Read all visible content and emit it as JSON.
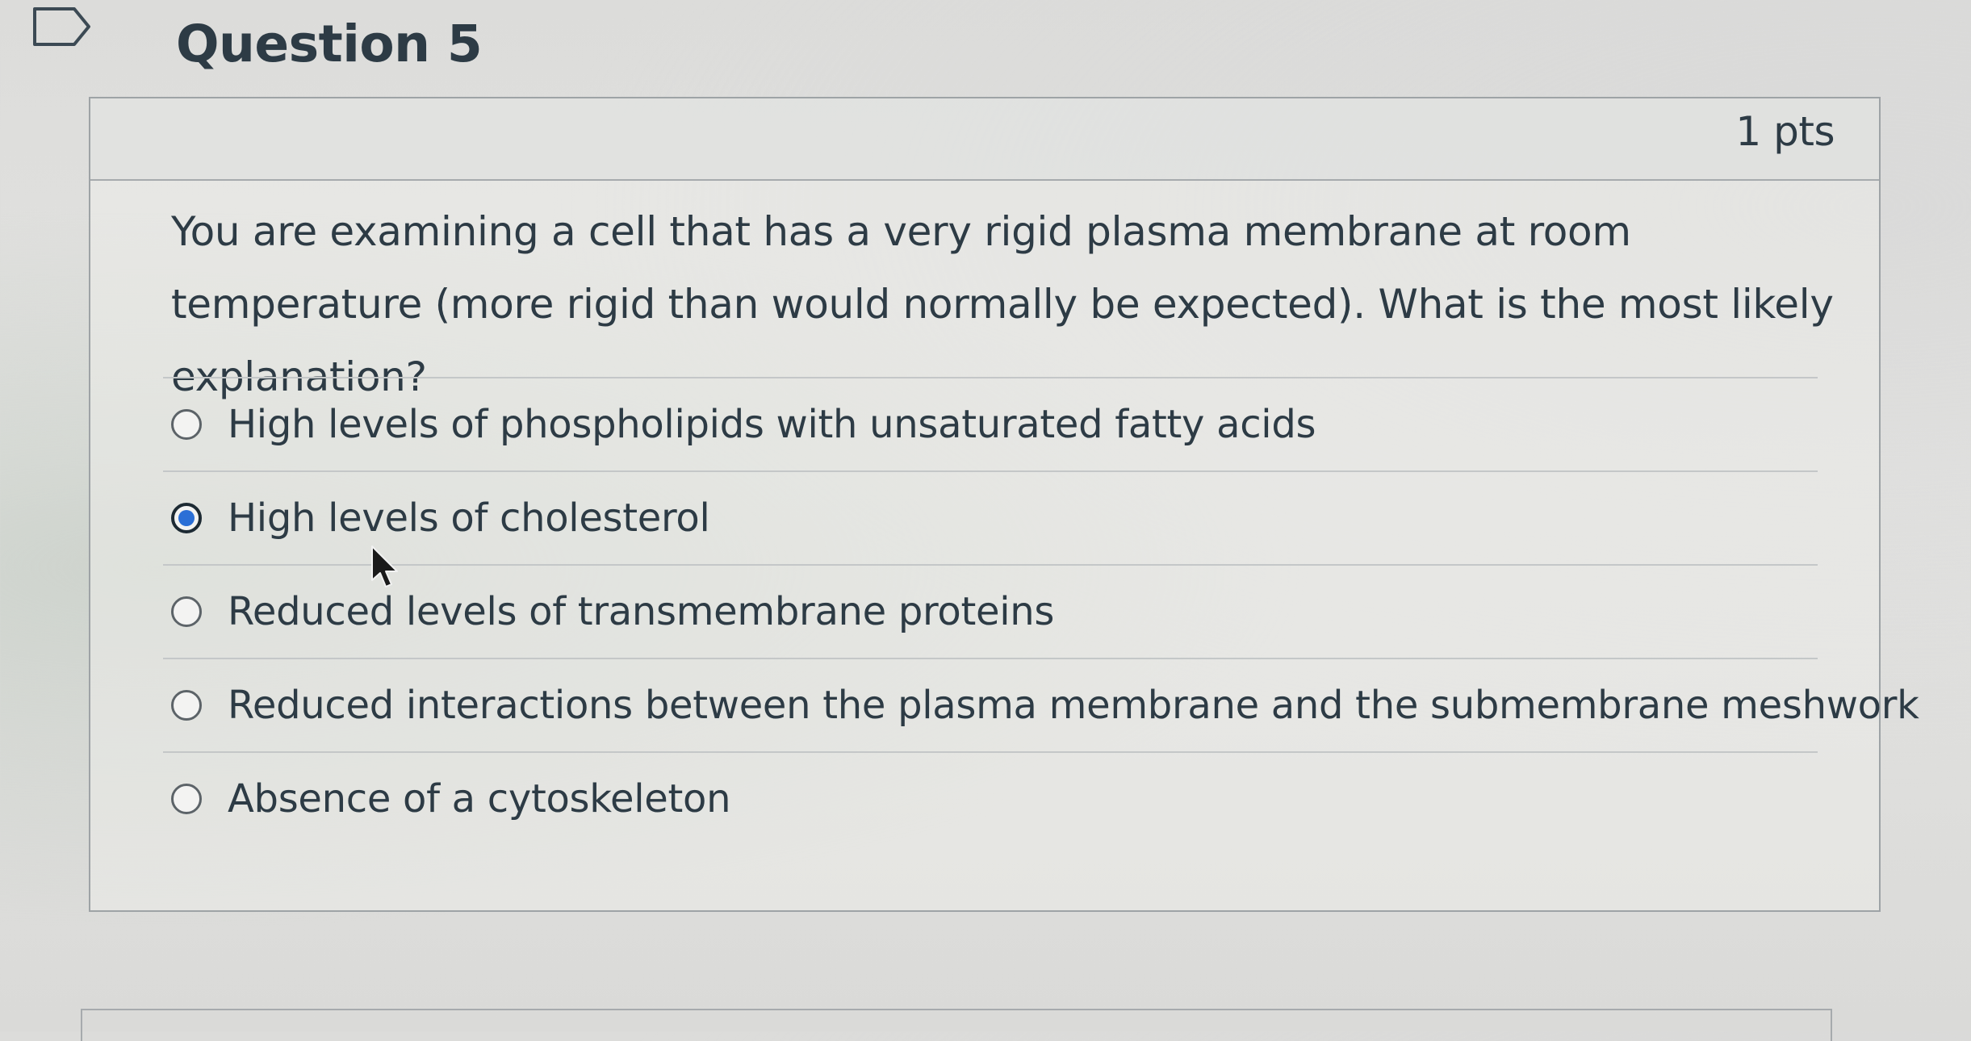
{
  "question": {
    "title": "Question 5",
    "points": "1 pts",
    "text": "You are examining a cell that has a very rigid plasma membrane at room temperature (more rigid than would normally be expected). What is the most likely explanation?",
    "selected_index": 1,
    "answers": [
      {
        "label": "High levels of phospholipids with unsaturated fatty acids",
        "checked": false
      },
      {
        "label": "High levels of cholesterol",
        "checked": true
      },
      {
        "label": "Reduced levels of transmembrane proteins",
        "checked": false
      },
      {
        "label": "Reduced interactions between the plasma membrane and the submembrane meshwork",
        "checked": false
      },
      {
        "label": "Absence of a cytoskeleton",
        "checked": false
      }
    ]
  },
  "icons": {
    "flag": "flag-outline-icon",
    "cursor": "mouse-pointer-icon"
  },
  "colors": {
    "text": "#2d3b45",
    "radio_selected": "#2b6fd6",
    "border": "#9ea3a6"
  }
}
